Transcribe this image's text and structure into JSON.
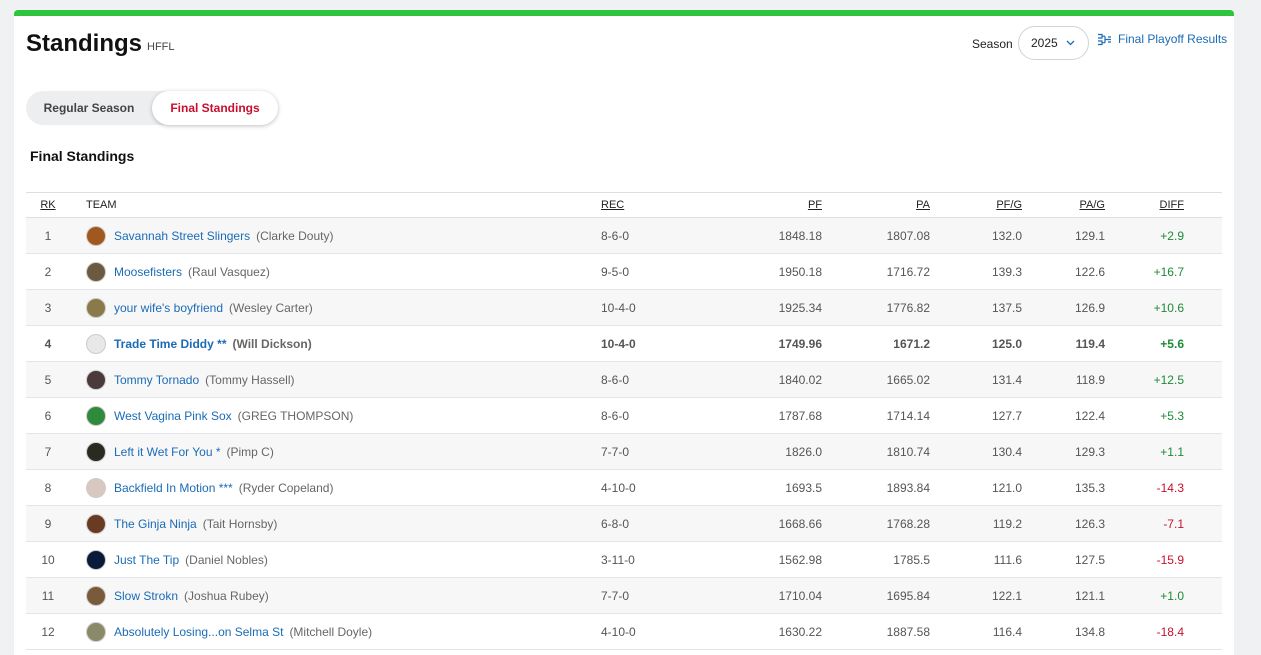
{
  "header": {
    "title": "Standings",
    "league": "HFFL"
  },
  "season": {
    "label": "Season",
    "value": "2025"
  },
  "playoff_link": "Final Playoff Results",
  "toggle": {
    "regular": "Regular Season",
    "final": "Final Standings"
  },
  "section_title": "Final Standings",
  "columns": {
    "rk": "RK",
    "team": "TEAM",
    "rec": "REC",
    "pf": "PF",
    "pa": "PA",
    "pfg": "PF/G",
    "pag": "PA/G",
    "diff": "DIFF"
  },
  "rows": [
    {
      "rk": "1",
      "team": "Savannah Street Slingers",
      "owner": "(Clarke Douty)",
      "rec": "8-6-0",
      "pf": "1848.18",
      "pa": "1807.08",
      "pfg": "132.0",
      "pag": "129.1",
      "diff": "+2.9",
      "avatar": "#a0581c"
    },
    {
      "rk": "2",
      "team": "Moosefisters",
      "owner": "(Raul Vasquez)",
      "rec": "9-5-0",
      "pf": "1950.18",
      "pa": "1716.72",
      "pfg": "139.3",
      "pag": "122.6",
      "diff": "+16.7",
      "avatar": "#6b5a3e"
    },
    {
      "rk": "3",
      "team": "your wife's boyfriend",
      "owner": "(Wesley Carter)",
      "rec": "10-4-0",
      "pf": "1925.34",
      "pa": "1776.82",
      "pfg": "137.5",
      "pag": "126.9",
      "diff": "+10.6",
      "avatar": "#8a7a4a"
    },
    {
      "rk": "4",
      "team": "Trade Time Diddy **",
      "owner": "(Will Dickson)",
      "rec": "10-4-0",
      "pf": "1749.96",
      "pa": "1671.2",
      "pfg": "125.0",
      "pag": "119.4",
      "diff": "+5.6",
      "avatar": "#e8e8e8"
    },
    {
      "rk": "5",
      "team": "Tommy Tornado",
      "owner": "(Tommy Hassell)",
      "rec": "8-6-0",
      "pf": "1840.02",
      "pa": "1665.02",
      "pfg": "131.4",
      "pag": "118.9",
      "diff": "+12.5",
      "avatar": "#4a3a3a"
    },
    {
      "rk": "6",
      "team": "West Vagina Pink Sox",
      "owner": "(GREG THOMPSON)",
      "rec": "8-6-0",
      "pf": "1787.68",
      "pa": "1714.14",
      "pfg": "127.7",
      "pag": "122.4",
      "diff": "+5.3",
      "avatar": "#2f8a3c"
    },
    {
      "rk": "7",
      "team": "Left it Wet For You *",
      "owner": "(Pimp C)",
      "rec": "7-7-0",
      "pf": "1826.0",
      "pa": "1810.74",
      "pfg": "130.4",
      "pag": "129.3",
      "diff": "+1.1",
      "avatar": "#2a2a22"
    },
    {
      "rk": "8",
      "team": "Backfield In Motion ***",
      "owner": "(Ryder Copeland)",
      "rec": "4-10-0",
      "pf": "1693.5",
      "pa": "1893.84",
      "pfg": "121.0",
      "pag": "135.3",
      "diff": "-14.3",
      "avatar": "#d9c8c0"
    },
    {
      "rk": "9",
      "team": "The Ginja Ninja",
      "owner": "(Tait Hornsby)",
      "rec": "6-8-0",
      "pf": "1668.66",
      "pa": "1768.28",
      "pfg": "119.2",
      "pag": "126.3",
      "diff": "-7.1",
      "avatar": "#6a3a22"
    },
    {
      "rk": "10",
      "team": "Just The Tip",
      "owner": "(Daniel Nobles)",
      "rec": "3-11-0",
      "pf": "1562.98",
      "pa": "1785.5",
      "pfg": "111.6",
      "pag": "127.5",
      "diff": "-15.9",
      "avatar": "#0b1a3a"
    },
    {
      "rk": "11",
      "team": "Slow Strokn",
      "owner": "(Joshua Rubey)",
      "rec": "7-7-0",
      "pf": "1710.04",
      "pa": "1695.84",
      "pfg": "122.1",
      "pag": "121.1",
      "diff": "+1.0",
      "avatar": "#7a5a3a"
    },
    {
      "rk": "12",
      "team": "Absolutely Losing...on Selma St",
      "owner": "(Mitchell Doyle)",
      "rec": "4-10-0",
      "pf": "1630.22",
      "pa": "1887.58",
      "pfg": "116.4",
      "pag": "134.8",
      "diff": "-18.4",
      "avatar": "#8a8a6a"
    }
  ],
  "highlight_rank": "4",
  "colors": {
    "accent_bar": "#2fc33e",
    "link": "#1b6bb5",
    "positive": "#1e8a35",
    "negative": "#c8102e"
  }
}
